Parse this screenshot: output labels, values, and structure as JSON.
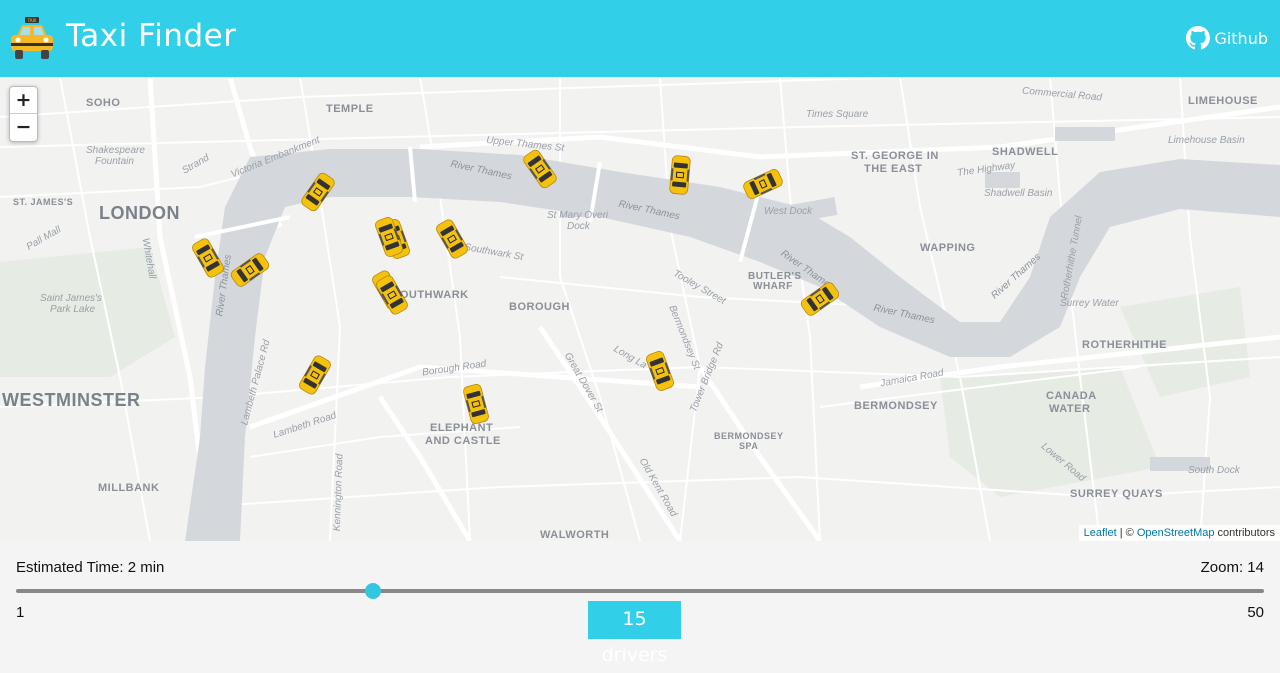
{
  "header": {
    "title": "Taxi Finder",
    "github_label": "Github",
    "logo_icon": "taxi-icon",
    "github_icon": "github-icon",
    "accent_color": "#32d0e8"
  },
  "map": {
    "zoom_in_label": "+",
    "zoom_out_label": "−",
    "attribution": {
      "leaflet": "Leaflet",
      "separator": " | © ",
      "osm": "OpenStreetMap",
      "suffix": " contributors"
    },
    "places": {
      "soho": "SOHO",
      "temple": "TEMPLE",
      "london": "LONDON",
      "st_james": "ST. JAMES'S",
      "westminster": "WESTMINSTER",
      "millbank": "MILLBANK",
      "southwark": "SOUTHWARK",
      "borough": "BOROUGH",
      "elephant": "ELEPHANT",
      "and_castle": "AND CASTLE",
      "walworth": "WALWORTH",
      "bermondsey": "BERMONDSEY",
      "bermondsey_spa_1": "BERMONDSEY",
      "bermondsey_spa_2": "SPA",
      "butlers_1": "BUTLER'S",
      "butlers_2": "WHARF",
      "st_george_1": "ST. GEORGE IN",
      "st_george_2": "THE EAST",
      "shadwell": "SHADWELL",
      "limehouse": "LIMEHOUSE",
      "wapping": "WAPPING",
      "rotherhithe": "ROTHERHITHE",
      "canada_water_1": "CANADA",
      "canada_water_2": "WATER",
      "surrey_quays": "SURREY QUAYS"
    },
    "streets": {
      "commercial_road": "Commercial Road",
      "upper_thames": "Upper Thames St",
      "victoria_embankment": "Victoria Embankment",
      "strand": "Strand",
      "whitehall": "Whitehall",
      "pall_mall": "Pall Mall",
      "southwark_st": "Southwark St",
      "borough_road": "Borough Road",
      "lambeth_road": "Lambeth Road",
      "lambeth_palace_rd": "Lambeth Palace Rd",
      "kennington_road": "Kennington Road",
      "tooley_street": "Tooley Street",
      "bermondsey_st": "Bermondsey St",
      "tower_bridge_rd": "Tower Bridge Rd",
      "great_dover_st": "Great Dover St",
      "old_kent_road": "Old Kent Road",
      "jamaica_road": "Jamaica Road",
      "lower_road": "Lower Road",
      "the_highway": "The Highway",
      "long_lane": "Long La",
      "rotherhithe_tunnel": "Rotherhithe Tunnel"
    },
    "pois": {
      "times_square": "Times Square",
      "shakespeare_1": "Shakespeare",
      "shakespeare_2": "Fountain",
      "st_james_park_1": "Saint James's",
      "st_james_park_2": "Park Lake",
      "st_mary_1": "St Mary Overi",
      "st_mary_2": "Dock",
      "west_dock": "West Dock",
      "limehouse_basin": "Limehouse Basin",
      "shadwell_basin": "Shadwell Basin",
      "surrey_water": "Surrey Water",
      "south_dock": "South Dock"
    },
    "river_labels": [
      "River Thames",
      "River Thames",
      "River Thames",
      "River Thames",
      "River Thames",
      "River Thames"
    ],
    "taxi_icon": "taxi-car-icon"
  },
  "panel": {
    "estimated_time": "Estimated Time: 2 min",
    "zoom_level": "Zoom: 14",
    "slider": {
      "min_label": "1",
      "max_label": "50",
      "min": 1,
      "max": 50,
      "value": 15
    },
    "drivers_label": "15 drivers"
  }
}
